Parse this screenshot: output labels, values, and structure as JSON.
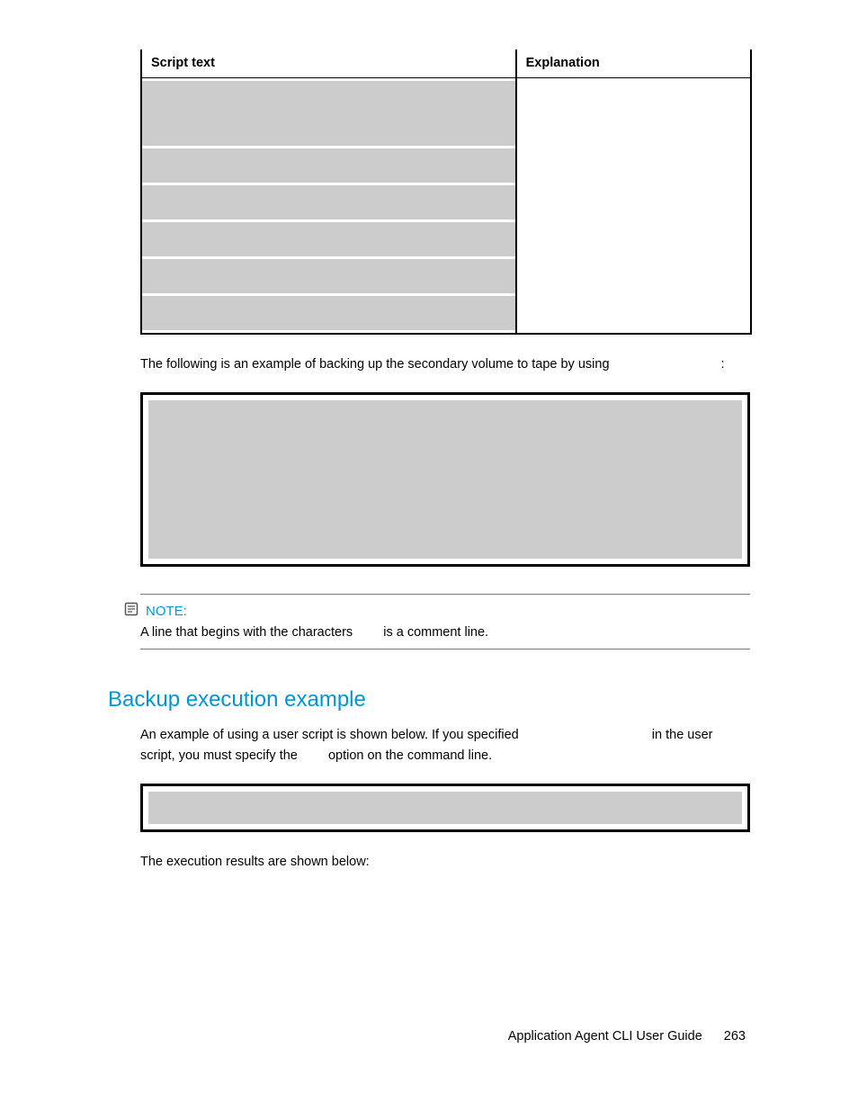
{
  "table": {
    "headers": {
      "col1": "Script text",
      "col2": "Explanation"
    }
  },
  "para1": "The following is an example of backing up the secondary volume to tape by using",
  "para1_end": ":",
  "note": {
    "label": "NOTE:",
    "body_1": "A line that begins with the characters",
    "body_2": "is a comment line."
  },
  "heading": "Backup execution example",
  "para2_a": "An example of using a user script is shown below. If you specified",
  "para2_b": "in the user script, you must specify the",
  "para2_c": "option on the command line.",
  "para3": "The execution results are shown below:",
  "footer": {
    "title": "Application Agent CLI User Guide",
    "page": "263"
  }
}
